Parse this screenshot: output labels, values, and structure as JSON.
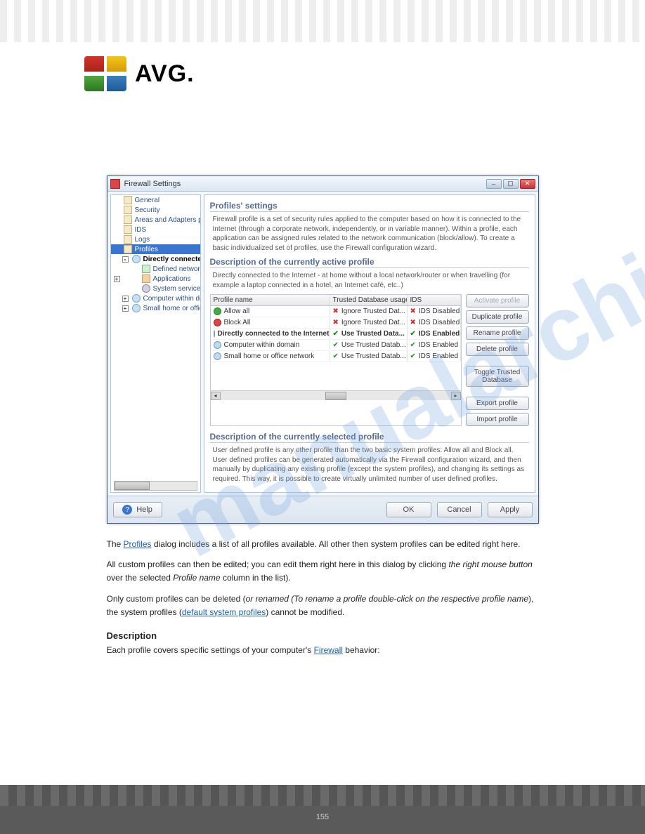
{
  "logo": {
    "text": "AVG"
  },
  "watermark": "manualarchives.com",
  "dialog": {
    "title": "Firewall Settings",
    "tree": [
      {
        "label": "General",
        "lvl": 0,
        "icon": "doc"
      },
      {
        "label": "Security",
        "lvl": 0,
        "icon": "doc"
      },
      {
        "label": "Areas and Adapters profiles",
        "lvl": 0,
        "icon": "doc"
      },
      {
        "label": "IDS",
        "lvl": 0,
        "icon": "doc"
      },
      {
        "label": "Logs",
        "lvl": 0,
        "icon": "doc"
      },
      {
        "label": "Profiles",
        "lvl": 0,
        "icon": "doc",
        "selected": true
      },
      {
        "label": "Directly connected to the",
        "lvl": 1,
        "icon": "person",
        "bold": true,
        "expander": "-"
      },
      {
        "label": "Defined networks",
        "lvl": 2,
        "icon": "net"
      },
      {
        "label": "Applications",
        "lvl": 2,
        "icon": "app",
        "expander": "+"
      },
      {
        "label": "System services",
        "lvl": 2,
        "icon": "gear"
      },
      {
        "label": "Computer within domain",
        "lvl": 1,
        "icon": "person",
        "expander": "+"
      },
      {
        "label": "Small home or office network",
        "lvl": 1,
        "icon": "person",
        "expander": "+"
      }
    ],
    "sections": {
      "profiles_heading": "Profiles' settings",
      "profiles_desc": "Firewall profile is a set of security rules applied to the computer based on how it is connected to the Internet (through a corporate network, independently, or in variable manner). Within a profile, each application can be assigned rules related to the network communication (block/allow). To create a basic individualized set of profiles, use the Firewall configuration wizard.",
      "active_heading": "Description of the currently active profile",
      "active_desc": "Directly connected to the Internet - at home without a local network/router or when travelling (for example a laptop connected in a hotel, an Internet café, etc..)",
      "selected_heading": "Description of the currently selected profile",
      "selected_desc": "User defined profile is any other profile than the two basic system profiles: Allow all and Block all. User defined profiles can be generated automatically via the Firewall configuration wizard, and then manually by duplicating any existing profile (except the system profiles), and changing its settings as required. This way, it is possible to create virtually unlimited number of user defined profiles."
    },
    "table": {
      "headers": {
        "name": "Profile name",
        "db": "Trusted Database usage",
        "ids": "IDS"
      },
      "rows": [
        {
          "icon": "allow",
          "name": "Allow all",
          "dbmark": "x",
          "db": "Ignore Trusted Dat...",
          "idsmark": "x",
          "ids": "IDS Disabled"
        },
        {
          "icon": "block",
          "name": "Block All",
          "dbmark": "x",
          "db": "Ignore Trusted Dat...",
          "idsmark": "x",
          "ids": "IDS Disabled"
        },
        {
          "icon": "user",
          "name": "Directly connected to the Internet",
          "dbmark": "v",
          "db": "Use Trusted Data...",
          "idsmark": "v",
          "ids": "IDS Enabled",
          "active": true
        },
        {
          "icon": "user",
          "name": "Computer within domain",
          "dbmark": "v",
          "db": "Use Trusted Datab...",
          "idsmark": "v",
          "ids": "IDS Enabled"
        },
        {
          "icon": "user",
          "name": "Small home or office network",
          "dbmark": "v",
          "db": "Use Trusted Datab...",
          "idsmark": "v",
          "ids": "IDS Enabled"
        }
      ]
    },
    "side_buttons": {
      "activate": "Activate profile",
      "duplicate": "Duplicate profile",
      "rename": "Rename profile",
      "delete": "Delete profile",
      "toggle": "Toggle Trusted Database",
      "export": "Export profile",
      "import": "Import profile"
    },
    "footer": {
      "help": "Help",
      "ok": "OK",
      "cancel": "Cancel",
      "apply": "Apply"
    }
  },
  "page_text": {
    "p1a": "The ",
    "p1b": "Profiles",
    "p1c": " dialog includes a list of all profiles available. All other then system profiles can be edited right here.",
    "p2a": "All custom profiles can then be edited; you can edit them right here in this dialog by clicking ",
    "p2link": "the right mouse button",
    "p2b": " over the selected ",
    "p2c": "Profile name",
    "p2d": " column in the list).",
    "p3a": "Only custom profiles can be deleted (",
    "p3b": "or renamed (To rename a profile double-click on the respective profile name",
    "p3c": "), the system profiles (",
    "p3d": "default system profiles",
    "p3e": ") cannot be modified.",
    "heading": "Description",
    "p4a": "Each profile covers specific settings of your computer's ",
    "p4link": "Firewall",
    "p4b": " behavior:"
  },
  "page_footer": "155"
}
